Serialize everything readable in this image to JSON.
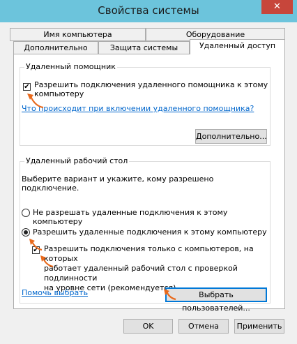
{
  "window": {
    "title": "Свойства системы",
    "close_glyph": "✕"
  },
  "tabs_row1": [
    {
      "label": "Имя компьютера"
    },
    {
      "label": "Оборудование"
    }
  ],
  "tabs_row2": [
    {
      "label": "Дополнительно"
    },
    {
      "label": "Защита системы"
    },
    {
      "label": "Удаленный доступ",
      "active": true
    }
  ],
  "remote_assistance": {
    "group_title": "Удаленный помощник",
    "allow_label_line1": "Разрешить подключения удаленного помощника к этому",
    "allow_label_line2": "компьютеру",
    "allow_checked": true,
    "info_link": "Что происходит при включении удаленного помощника?",
    "advanced_button": "Дополнительно..."
  },
  "remote_desktop": {
    "group_title": "Удаленный рабочий стол",
    "instruction": "Выберите вариант и укажите, кому разрешено подключение.",
    "option_deny": "Не разрешать удаленные подключения к этому компьютеру",
    "option_allow": "Разрешить удаленные подключения к этому компьютеру",
    "selected": "allow",
    "nla_line1": "Разрешить подключения только с компьютеров, на которых",
    "nla_line2": "работает удаленный рабочий стол с проверкой подлинности",
    "nla_line3": "на уровне сети (рекомендуется)",
    "nla_checked": true,
    "help_link": "Помочь выбрать",
    "select_users_button": "Выбрать пользователей..."
  },
  "footer": {
    "ok_button": "OK",
    "cancel_button": "Отмена",
    "apply_button": "Применить"
  },
  "colors": {
    "titlebar": "#6cc4dc",
    "close_button": "#c7463b",
    "link": "#0066cc",
    "annotation_arrow": "#e8691c"
  }
}
